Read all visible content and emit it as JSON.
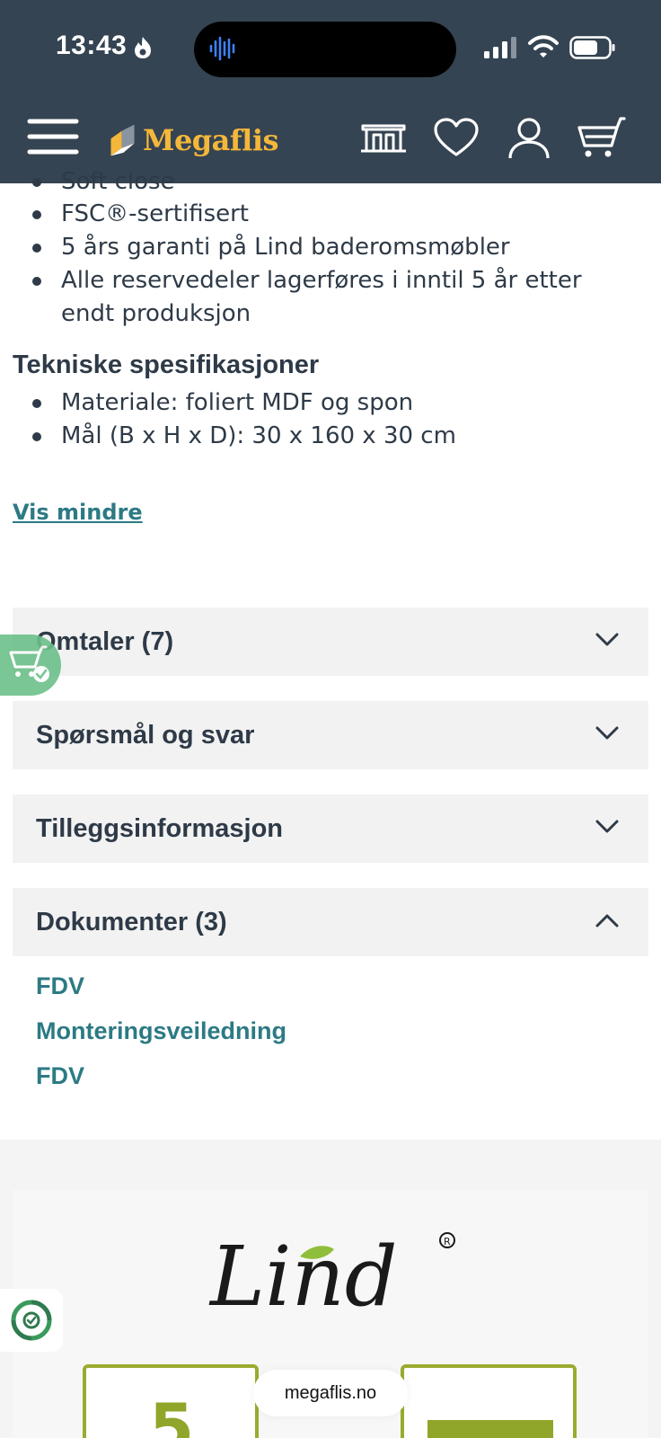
{
  "status_bar": {
    "time": "13:43"
  },
  "header": {
    "logo_text": "Megaflis",
    "brand_color": "#f4b73a",
    "background": "#354452"
  },
  "features": {
    "cut_item": "Soft close",
    "items": [
      "FSC®-sertifisert",
      "5 års garanti på Lind baderomsmøbler",
      "Alle reservedeler lagerføres i inntil 5 år etter endt produksjon"
    ]
  },
  "specs": {
    "title": "Tekniske spesifikasjoner",
    "items": [
      "Materiale: foliert MDF og spon",
      "Mål (B x H x D): 30 x 160 x 30 cm"
    ]
  },
  "toggle_link": "Vis mindre",
  "accordions": [
    {
      "title": "Omtaler (7)",
      "expanded": false
    },
    {
      "title": "Spørsmål og svar",
      "expanded": false
    },
    {
      "title": "Tilleggsinformasjon",
      "expanded": false
    },
    {
      "title": "Dokumenter (3)",
      "expanded": true
    }
  ],
  "documents": [
    "FDV",
    "Monteringsveiledning",
    "FDV"
  ],
  "brand": {
    "logo_text": "Lind",
    "badge_number": "5"
  },
  "browser": {
    "url": "megaflis.no"
  },
  "accent_color": "#2c7a84"
}
